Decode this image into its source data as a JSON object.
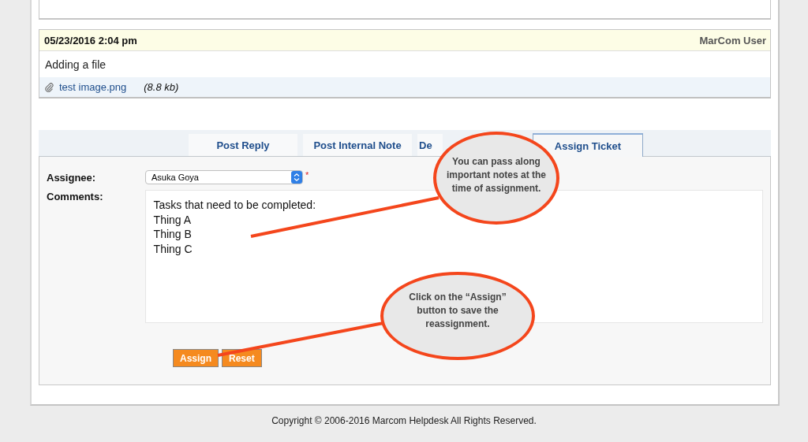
{
  "note": {
    "timestamp": "05/23/2016 2:04 pm",
    "author": "MarCom User",
    "message": "Adding a file",
    "attachment": {
      "name": "test image.png",
      "size": "(8.8 kb)"
    }
  },
  "tabs": [
    {
      "label": "Post Reply",
      "selected": false
    },
    {
      "label": "Post Internal Note",
      "selected": false
    },
    {
      "label": "De",
      "selected": false
    },
    {
      "label": "Assign Ticket",
      "selected": true
    }
  ],
  "form": {
    "assignee_label": "Assignee:",
    "assignee": "Asuka Goya",
    "required_mark": "*",
    "comments_label": "Comments:",
    "comments": [
      "Tasks that need to be completed:",
      "Thing A",
      "Thing B",
      "Thing C"
    ],
    "buttons": [
      "Assign",
      "Reset"
    ]
  },
  "callouts": [
    "You can pass along important notes at the time of assignment.",
    "Click on the “Assign” button to save the reassignment."
  ],
  "footer": "Copyright © 2006-2016 Marcom Helpdesk All Rights Reserved."
}
